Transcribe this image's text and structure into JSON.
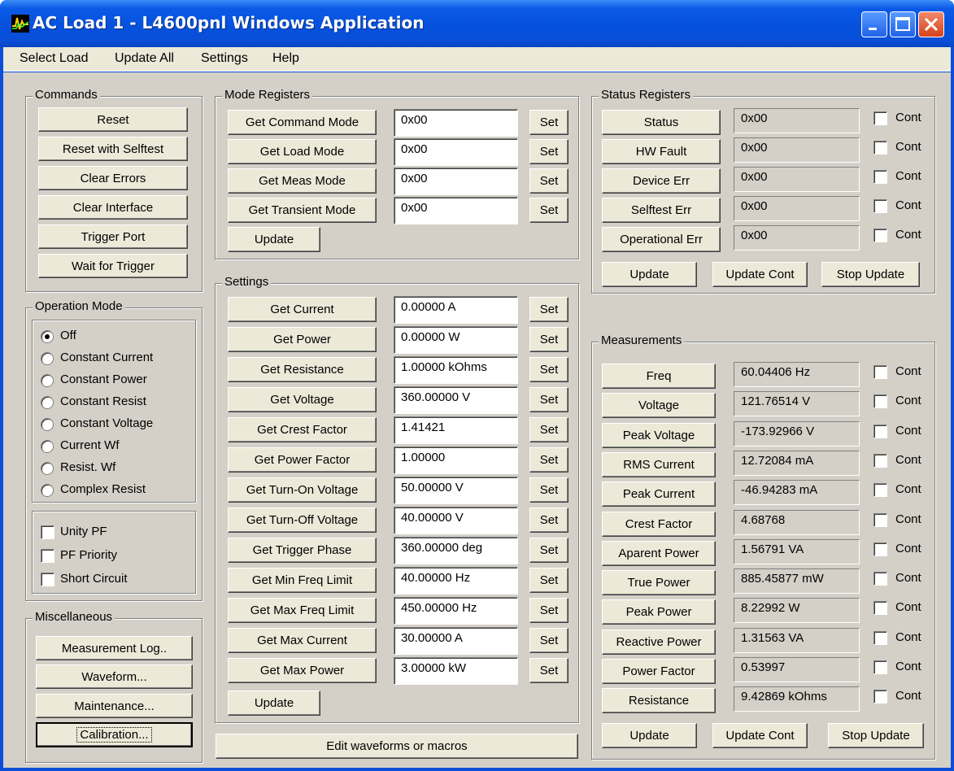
{
  "window": {
    "title": "AC Load 1 - L4600pnl Windows Application"
  },
  "menu": [
    "Select Load",
    "Update All",
    "Settings",
    "Help"
  ],
  "commands": {
    "title": "Commands",
    "buttons": [
      "Reset",
      "Reset with Selftest",
      "Clear Errors",
      "Clear Interface",
      "Trigger Port",
      "Wait for Trigger"
    ]
  },
  "operation_mode": {
    "title": "Operation Mode",
    "options": [
      "Off",
      "Constant Current",
      "Constant Power",
      "Constant Resist",
      "Constant Voltage",
      "Current Wf",
      "Resist. Wf",
      "Complex Resist"
    ],
    "selected": "Off",
    "checks": [
      "Unity PF",
      "PF Priority",
      "Short Circuit"
    ]
  },
  "misc": {
    "title": "Miscellaneous",
    "buttons": [
      "Measurement Log..",
      "Waveform...",
      "Maintenance...",
      "Calibration..."
    ]
  },
  "mode_registers": {
    "title": "Mode Registers",
    "rows": [
      {
        "label": "Get Command Mode",
        "value": "0x00"
      },
      {
        "label": "Get Load Mode",
        "value": "0x00"
      },
      {
        "label": "Get Meas Mode",
        "value": "0x00"
      },
      {
        "label": "Get Transient Mode",
        "value": "0x00"
      }
    ],
    "set_label": "Set",
    "update_label": "Update"
  },
  "settings": {
    "title": "Settings",
    "rows": [
      {
        "label": "Get Current",
        "value": "0.00000 A"
      },
      {
        "label": "Get Power",
        "value": "0.00000 W"
      },
      {
        "label": "Get Resistance",
        "value": "1.00000 kOhms"
      },
      {
        "label": "Get Voltage",
        "value": "360.00000 V"
      },
      {
        "label": "Get Crest Factor",
        "value": "1.41421"
      },
      {
        "label": "Get Power Factor",
        "value": "1.00000"
      },
      {
        "label": "Get Turn-On Voltage",
        "value": "50.00000 V"
      },
      {
        "label": "Get Turn-Off Voltage",
        "value": "40.00000 V"
      },
      {
        "label": "Get Trigger Phase",
        "value": "360.00000 deg"
      },
      {
        "label": "Get Min Freq Limit",
        "value": "40.00000 Hz"
      },
      {
        "label": "Get Max Freq Limit",
        "value": "450.00000 Hz"
      },
      {
        "label": "Get Max Current",
        "value": "30.00000 A"
      },
      {
        "label": "Get Max Power",
        "value": "3.00000 kW"
      }
    ],
    "set_label": "Set",
    "update_label": "Update",
    "edit_label": "Edit waveforms or macros"
  },
  "status_registers": {
    "title": "Status Registers",
    "rows": [
      {
        "label": "Status",
        "value": "0x00"
      },
      {
        "label": "HW Fault",
        "value": "0x00"
      },
      {
        "label": "Device Err",
        "value": "0x00"
      },
      {
        "label": "Selftest Err",
        "value": "0x00"
      },
      {
        "label": "Operational Err",
        "value": "0x00"
      }
    ],
    "cont_label": "Cont",
    "buttons": [
      "Update",
      "Update Cont",
      "Stop Update"
    ]
  },
  "measurements": {
    "title": "Measurements",
    "rows": [
      {
        "label": "Freq",
        "value": "60.04406 Hz"
      },
      {
        "label": "Voltage",
        "value": "121.76514 V"
      },
      {
        "label": "Peak Voltage",
        "value": "-173.92966 V"
      },
      {
        "label": "RMS Current",
        "value": "12.72084 mA"
      },
      {
        "label": "Peak Current",
        "value": "-46.94283 mA"
      },
      {
        "label": "Crest Factor",
        "value": "4.68768"
      },
      {
        "label": "Aparent Power",
        "value": "1.56791 VA"
      },
      {
        "label": "True Power",
        "value": "885.45877 mW"
      },
      {
        "label": "Peak Power",
        "value": "8.22992 W"
      },
      {
        "label": "Reactive Power",
        "value": "1.31563 VA"
      },
      {
        "label": "Power Factor",
        "value": "0.53997"
      },
      {
        "label": "Resistance",
        "value": "9.42869 kOhms"
      }
    ],
    "cont_label": "Cont",
    "buttons": [
      "Update",
      "Update Cont",
      "Stop Update"
    ]
  }
}
